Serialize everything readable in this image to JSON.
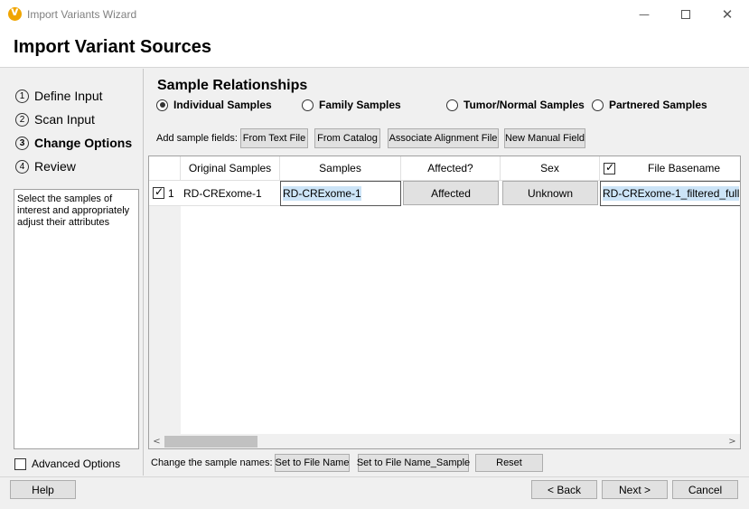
{
  "window": {
    "title": "Import Variants Wizard"
  },
  "header": {
    "title": "Import Variant Sources"
  },
  "steps": [
    {
      "num": "1",
      "label": "Define Input"
    },
    {
      "num": "2",
      "label": "Scan Input"
    },
    {
      "num": "3",
      "label": "Change Options"
    },
    {
      "num": "4",
      "label": "Review"
    }
  ],
  "help_text": "Select the samples of interest and appropriately adjust their attributes",
  "advanced_options": {
    "label": "Advanced Options",
    "checked": false
  },
  "section_title": "Sample Relationships",
  "radio_options": [
    {
      "label": "Individual Samples",
      "selected": true
    },
    {
      "label": "Family Samples",
      "selected": false
    },
    {
      "label": "Tumor/Normal Samples",
      "selected": false
    },
    {
      "label": "Partnered Samples",
      "selected": false
    }
  ],
  "add_fields": {
    "label": "Add sample fields:",
    "buttons": [
      "From Text File",
      "From Catalog",
      "Associate Alignment File",
      "New Manual Field"
    ]
  },
  "table": {
    "columns": [
      "Original Samples",
      "Samples",
      "Affected?",
      "Sex",
      "File Basename"
    ],
    "rows": [
      {
        "checked": true,
        "index": "1",
        "original": "RD-CRExome-1",
        "sample": "RD-CRExome-1",
        "affected": "Affected",
        "sex": "Unknown",
        "basename": "RD-CRExome-1_filtered_full"
      }
    ]
  },
  "rename": {
    "label": "Change the sample names:",
    "buttons": [
      "Set to File Name",
      "Set to File Name_Sample",
      "Reset"
    ]
  },
  "footer": {
    "help": "Help",
    "back": "< Back",
    "next": "Next >",
    "cancel": "Cancel"
  }
}
